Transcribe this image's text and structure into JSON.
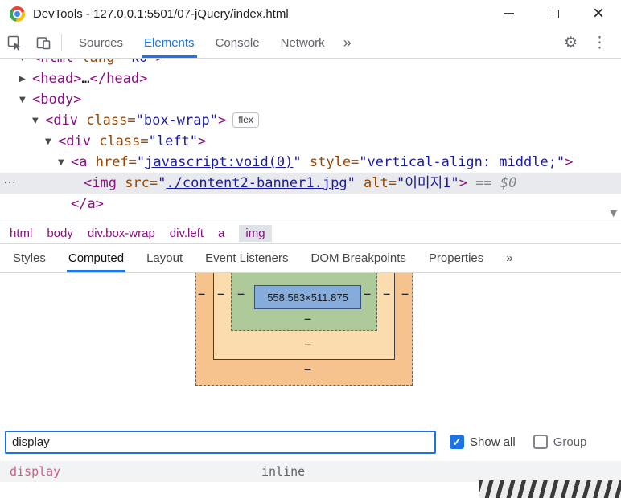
{
  "colors": {
    "accent_blue": "#1a73e8",
    "tag_purple": "#881280",
    "attr_orange": "#994500",
    "value_blue": "#1a1aa6",
    "selected_row_gray": "#e8eaed",
    "box_margin": "#f6c28d",
    "box_border": "#fbdcae",
    "box_padding": "#aec99a",
    "box_content": "#85acdb",
    "property_pink": "#c95f87"
  },
  "icons": {
    "collapsed": "▶",
    "expanded": "▼",
    "more_dots": "⋯",
    "overflow": "»",
    "gear": "⚙",
    "menu_dots": "⋮",
    "dash": "−",
    "check": "✓",
    "close": "×",
    "scroll_down": "▼"
  },
  "titlebar": {
    "title": "DevTools - 127.0.0.1:5501/07-jQuery/index.html"
  },
  "toolbar": {
    "tabs": [
      {
        "label": "Sources"
      },
      {
        "label": "Elements"
      },
      {
        "label": "Console"
      },
      {
        "label": "Network"
      }
    ]
  },
  "dom_tree": {
    "clipped": {
      "open": "<html",
      "attr": " lang=",
      "val": "\"ko\"",
      "close": ">"
    },
    "head": {
      "open": "<head>",
      "ellipsis": "…",
      "close": "</head>"
    },
    "body_open": "<body>",
    "boxwrap": {
      "open": "<div",
      "attr": " class=",
      "val": "\"box-wrap\"",
      "close": ">",
      "badge": "flex"
    },
    "left": {
      "open": "<div",
      "attr": " class=",
      "val": "\"left\"",
      "close": ">"
    },
    "anchor": {
      "open": "<a",
      "attr1": " href=",
      "q1": "\"",
      "link": "javascript:void(0)",
      "q2": "\"",
      "attr2": " style=",
      "val2": "\"vertical-align: middle;\"",
      "close": ">"
    },
    "img": {
      "open": "<img",
      "attr1": " src=",
      "q1": "\"",
      "link": "./content2-banner1.jpg",
      "q2": "\"",
      "attr2": " alt=",
      "val2": "\"이미지1\"",
      "close": ">",
      "meta": " == ",
      "dollar": "$0"
    },
    "anchor_close": "</a>"
  },
  "breadcrumbs": {
    "items": [
      {
        "label": "html"
      },
      {
        "label": "body"
      },
      {
        "label": "div.box-wrap"
      },
      {
        "label": "div.left"
      },
      {
        "label": "a"
      },
      {
        "label": "img"
      }
    ]
  },
  "sidebar_tabs": {
    "items": [
      {
        "label": "Styles"
      },
      {
        "label": "Computed"
      },
      {
        "label": "Layout"
      },
      {
        "label": "Event Listeners"
      },
      {
        "label": "DOM Breakpoints"
      },
      {
        "label": "Properties"
      }
    ]
  },
  "box_model": {
    "content_size": "558.583×511.875",
    "dash": "−"
  },
  "filter": {
    "value": "display",
    "show_all_label": "Show all",
    "group_label": "Group"
  },
  "computed_properties": {
    "rows": [
      {
        "name": "display",
        "value": "inline"
      }
    ]
  }
}
